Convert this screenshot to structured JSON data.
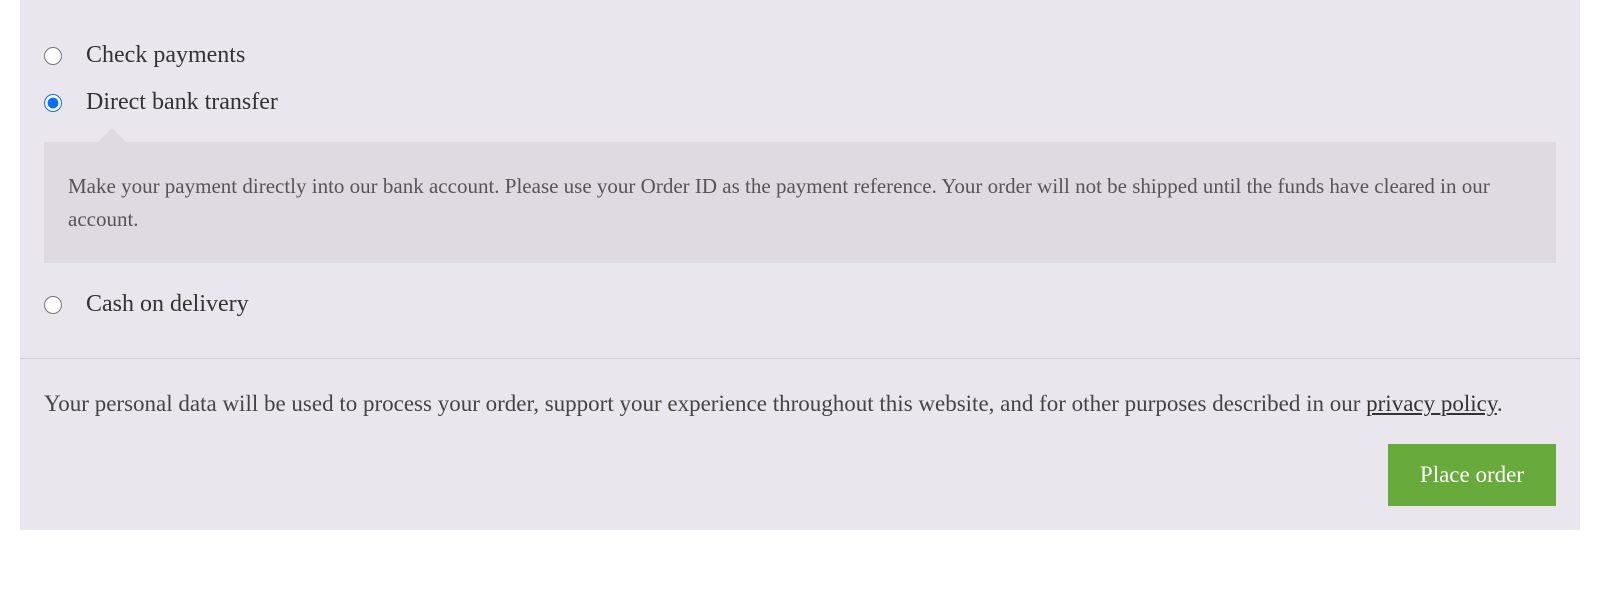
{
  "payment_methods": {
    "options": [
      {
        "id": "check",
        "label": "Check payments",
        "selected": false
      },
      {
        "id": "bank",
        "label": "Direct bank transfer",
        "selected": true,
        "description": "Make your payment directly into our bank account. Please use your Order ID as the payment reference. Your order will not be shipped until the funds have cleared in our account."
      },
      {
        "id": "cod",
        "label": "Cash on delivery",
        "selected": false
      }
    ]
  },
  "privacy": {
    "text_before": "Your personal data will be used to process your order, support your experience throughout this website, and for other purposes described in our ",
    "link_label": "privacy policy",
    "text_after": "."
  },
  "actions": {
    "place_order_label": "Place order"
  },
  "colors": {
    "panel_bg": "#e9e6ed",
    "desc_bg": "#dfd9e2",
    "button_bg": "#68aa3b",
    "button_fg": "#ffffff",
    "radio_accent": "#0d6efd"
  }
}
